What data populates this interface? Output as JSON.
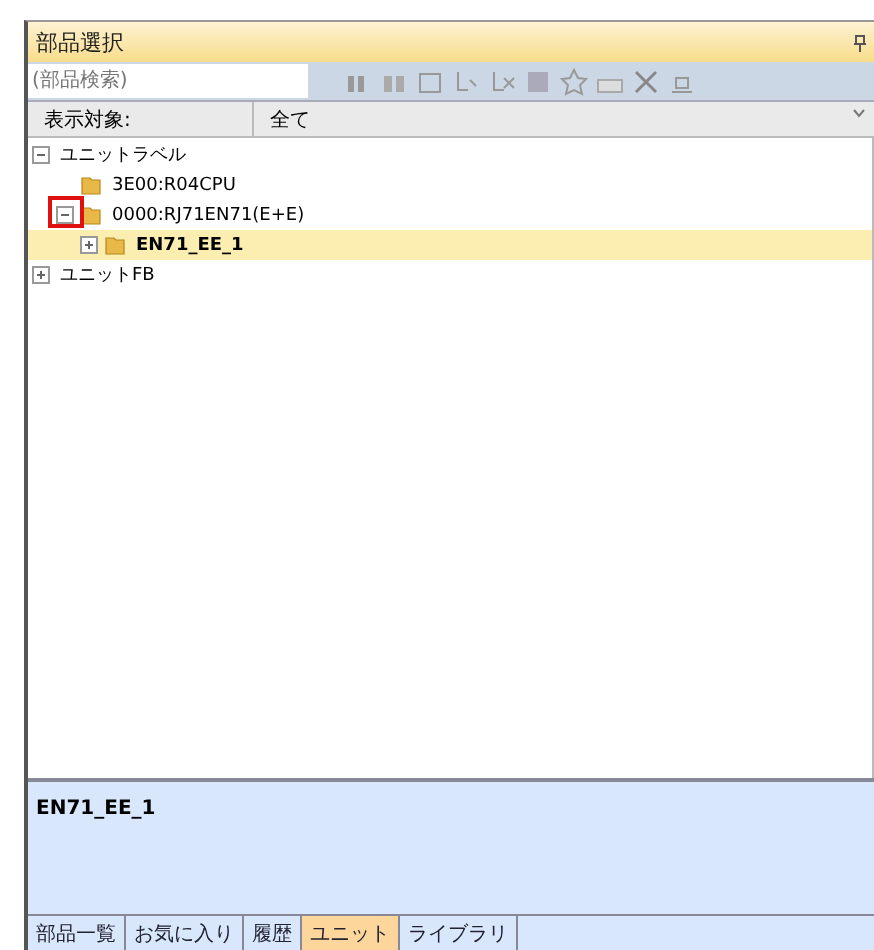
{
  "window": {
    "title": "部品選択"
  },
  "search": {
    "placeholder": "(部品検索)"
  },
  "filter": {
    "label": "表示対象:",
    "value": "全て"
  },
  "tree": [
    {
      "label": "ユニットラベル",
      "expanded": true,
      "selected": false,
      "children": [
        {
          "label": "3E00:R04CPU",
          "folder": true,
          "selected": false
        },
        {
          "label": "0000:RJ71EN71(E+E)",
          "folder": true,
          "expanded": true,
          "selected": false,
          "highlighted": true,
          "children": [
            {
              "label": "EN71_EE_1",
              "folder": true,
              "expanded": false,
              "selected": true
            }
          ]
        }
      ]
    },
    {
      "label": "ユニットFB",
      "expanded": false,
      "selected": false
    }
  ],
  "description": "EN71_EE_1",
  "tabs": [
    {
      "label": "部品一覧",
      "selected": false
    },
    {
      "label": "お気に入り",
      "selected": false
    },
    {
      "label": "履歴",
      "selected": false
    },
    {
      "label": "ユニット",
      "selected": true
    },
    {
      "label": "ライブラリ",
      "selected": false
    }
  ]
}
